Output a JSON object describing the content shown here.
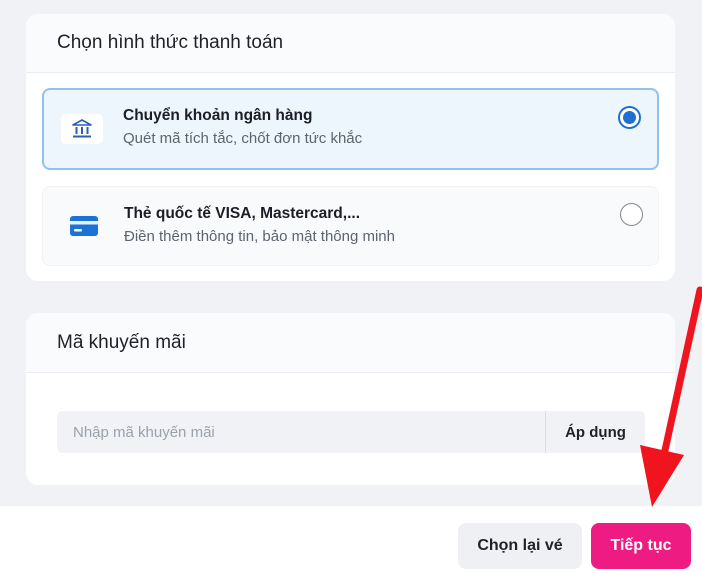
{
  "payment": {
    "title": "Chọn hình thức thanh toán",
    "options": [
      {
        "title": "Chuyển khoản ngân hàng",
        "subtitle": "Quét mã tích tắc, chốt đơn tức khắc",
        "icon": "bank-icon",
        "selected": true
      },
      {
        "title": "Thẻ quốc tế VISA, Mastercard,...",
        "subtitle": "Điền thêm thông tin, bảo mật thông minh",
        "icon": "credit-card-icon",
        "selected": false
      }
    ]
  },
  "promo": {
    "title": "Mã khuyến mãi",
    "placeholder": "Nhập mã khuyến mãi",
    "apply_label": "Áp dụng"
  },
  "footer": {
    "back_label": "Chọn lại vé",
    "next_label": "Tiếp tục"
  },
  "colors": {
    "primary": "#ee1c82",
    "selected_border": "#90c2ef",
    "selected_bg": "#edf5fd",
    "radio_active": "#1f6fd1",
    "annotation_arrow": "#f0141e"
  }
}
